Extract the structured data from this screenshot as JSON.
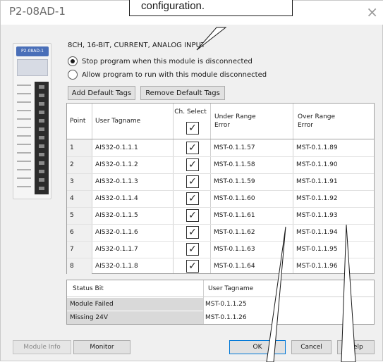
{
  "window": {
    "title": "P2-08AD-1",
    "close_glyph": "×"
  },
  "callout": {
    "text": "configuration."
  },
  "module_image": {
    "label": "P2-08AD-1"
  },
  "config": {
    "section_title": "8CH, 16-BIT, CURRENT, ANALOG INPUT",
    "option_stop": "Stop program when this module is disconnected",
    "option_allow": "Allow program to run with this module disconnected",
    "selected_option": "stop",
    "add_default_tags": "Add Default Tags",
    "remove_default_tags": "Remove Default Tags"
  },
  "grid": {
    "headers": {
      "point": "Point",
      "user_tagname": "User Tagname",
      "ch_select": "Ch. Select",
      "under_range": "Under Range\nError",
      "over_range": "Over Range\nError"
    },
    "header_check": "✓",
    "rows": [
      {
        "point": "1",
        "tag": "AIS32-0.1.1.1",
        "selected": "✓",
        "under": "MST-0.1.1.57",
        "over": "MST-0.1.1.89"
      },
      {
        "point": "2",
        "tag": "AIS32-0.1.1.2",
        "selected": "✓",
        "under": "MST-0.1.1.58",
        "over": "MST-0.1.1.90"
      },
      {
        "point": "3",
        "tag": "AIS32-0.1.1.3",
        "selected": "✓",
        "under": "MST-0.1.1.59",
        "over": "MST-0.1.1.91"
      },
      {
        "point": "4",
        "tag": "AIS32-0.1.1.4",
        "selected": "✓",
        "under": "MST-0.1.1.60",
        "over": "MST-0.1.1.92"
      },
      {
        "point": "5",
        "tag": "AIS32-0.1.1.5",
        "selected": "✓",
        "under": "MST-0.1.1.61",
        "over": "MST-0.1.1.93"
      },
      {
        "point": "6",
        "tag": "AIS32-0.1.1.6",
        "selected": "✓",
        "under": "MST-0.1.1.62",
        "over": "MST-0.1.1.94"
      },
      {
        "point": "7",
        "tag": "AIS32-0.1.1.7",
        "selected": "✓",
        "under": "MST-0.1.1.63",
        "over": "MST-0.1.1.95"
      },
      {
        "point": "8",
        "tag": "AIS32-0.1.1.8",
        "selected": "✓",
        "under": "MST-0.1.1.64",
        "over": "MST-0.1.1.96"
      }
    ]
  },
  "status_table": {
    "col_status_bit": "Status Bit",
    "col_user_tagname": "User Tagname",
    "rows": [
      {
        "bit": "Module Failed",
        "tag": "MST-0.1.1.25"
      },
      {
        "bit": "Missing 24V",
        "tag": "MST-0.1.1.26"
      }
    ]
  },
  "buttons": {
    "module_info": "Module Info",
    "monitor": "Monitor",
    "ok": "OK",
    "cancel": "Cancel",
    "help": "Help"
  },
  "colors": {
    "accent": "#0078d7",
    "module_blue": "#4a6fb8"
  }
}
